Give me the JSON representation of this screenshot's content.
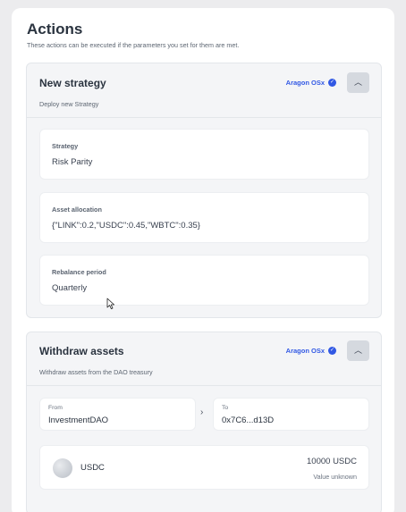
{
  "actions": {
    "title": "Actions",
    "subtitle": "These actions can be executed if the parameters you set for them are met."
  },
  "new_strategy": {
    "title": "New strategy",
    "badge": "Aragon OSx",
    "description": "Deploy new Strategy",
    "fields": [
      {
        "label": "Strategy",
        "value": "Risk Parity"
      },
      {
        "label": "Asset allocation",
        "value": "{\"LINK\":0.2,\"USDC\":0.45,\"WBTC\":0.35}"
      },
      {
        "label": "Rebalance period",
        "value": "Quarterly"
      }
    ]
  },
  "withdraw": {
    "title": "Withdraw assets",
    "badge": "Aragon OSx",
    "description": "Withdraw assets from the DAO treasury",
    "from_label": "From",
    "from_value": "InvestmentDAO",
    "to_label": "To",
    "to_value": "0x7C6...d13D",
    "token": {
      "symbol": "USDC",
      "amount": "10000 USDC",
      "value": "Value unknown"
    }
  },
  "colors": {
    "accent": "#3158e4",
    "background": "#ececee"
  },
  "icons": {
    "verified": "check-badge-icon",
    "collapse": "chevron-up-icon",
    "arrow": "chevron-right-icon"
  }
}
